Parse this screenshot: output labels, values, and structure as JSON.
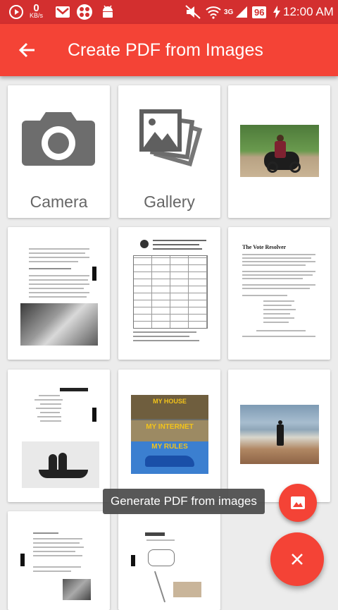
{
  "status_bar": {
    "speed_value": "0",
    "speed_unit": "KB/s",
    "network": "3G",
    "battery": "96",
    "time": "12:00 AM"
  },
  "app_bar": {
    "title": "Create PDF from Images",
    "back_icon": "arrow-back-icon"
  },
  "grid": {
    "camera_label": "Camera",
    "gallery_label": "Gallery",
    "doc_heading": "The Vote Resolver"
  },
  "fab": {
    "tooltip": "Generate PDF from images",
    "mini_icon": "image-icon",
    "main_icon": "close-icon"
  },
  "thumbnail_texts": {
    "poster_line_1": "MY HOUSE",
    "poster_line_2": "MY INTERNET",
    "poster_line_3": "MY RULES"
  },
  "colors": {
    "status_bar": "#d32f2f",
    "app_bar": "#f44336",
    "fab": "#f44336"
  }
}
